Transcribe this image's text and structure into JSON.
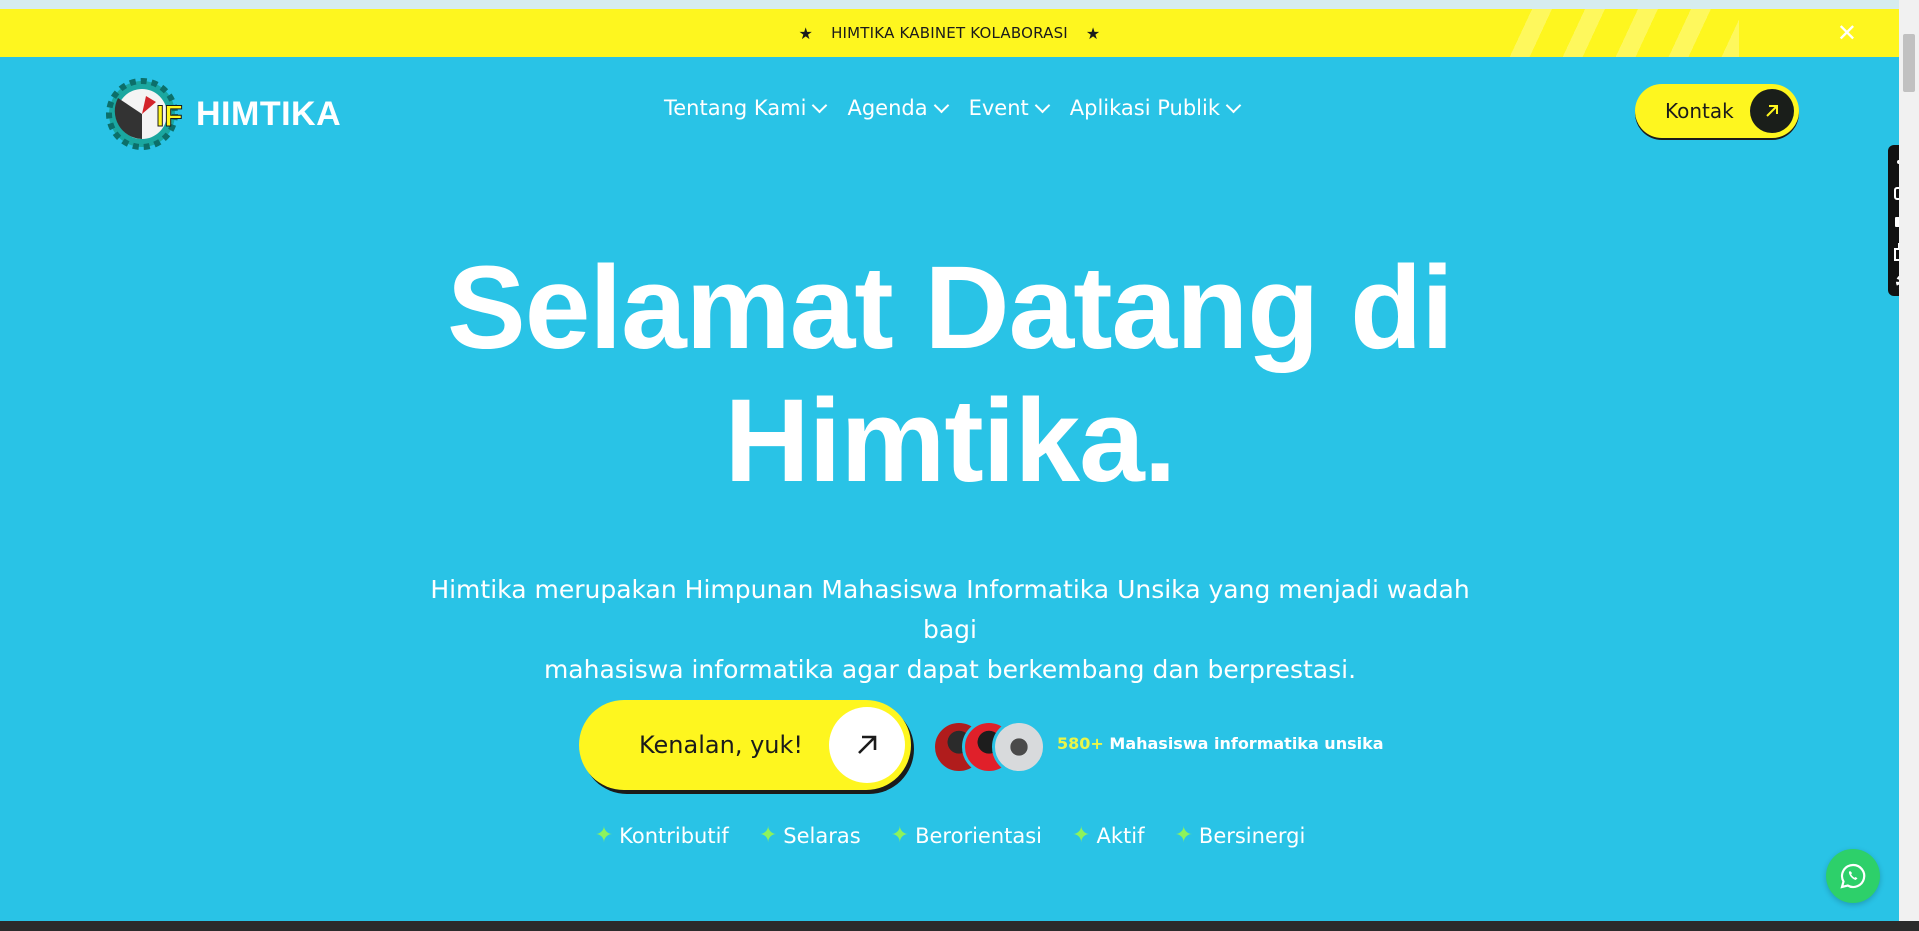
{
  "announcement": {
    "text": "HIMTIKA KABINET KOLABORASI",
    "star_icon": "star-icon",
    "close_icon": "close-icon"
  },
  "nav": {
    "logo_text": "HIMTIKA",
    "items": [
      {
        "label": "Tentang Kami"
      },
      {
        "label": "Agenda"
      },
      {
        "label": "Event"
      },
      {
        "label": "Aplikasi Publik"
      }
    ],
    "contact_label": "Kontak"
  },
  "hero": {
    "title_line1": "Selamat Datang di",
    "title_line2": "Himtika.",
    "subtitle_line1": "Himtika merupakan Himpunan Mahasiswa Informatika Unsika yang menjadi wadah bagi",
    "subtitle_line2": "mahasiswa informatika agar dapat berkembang dan berprestasi.",
    "cta_label": "Kenalan, yuk!",
    "member_count": "580+",
    "member_label": "Mahasiswa informatika unsika"
  },
  "values": [
    "Kontributif",
    "Selaras",
    "Berorientasi",
    "Aktif",
    "Bersinergi"
  ],
  "colors": {
    "background": "#29c3e6",
    "accent_yellow": "#fef61f",
    "dark": "#1a1e1a",
    "whatsapp": "#2dd06a",
    "spark_green": "#8ef35b"
  }
}
